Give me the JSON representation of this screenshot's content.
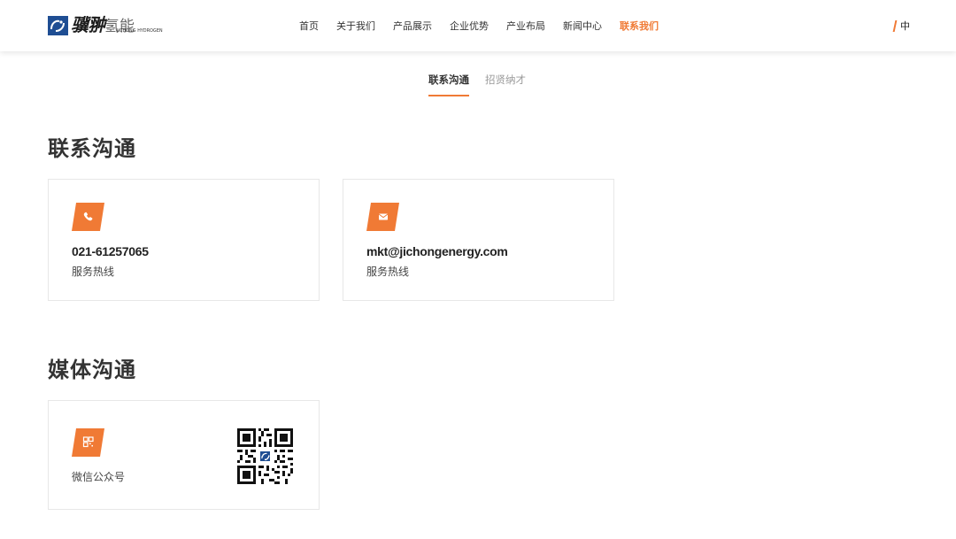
{
  "brand": {
    "name_cn": "骥翀",
    "name_cn_suffix": "氢能",
    "name_en": "JICHONG HYDROGEN"
  },
  "nav": {
    "items": [
      {
        "label": "首页"
      },
      {
        "label": "关于我们"
      },
      {
        "label": "产品展示"
      },
      {
        "label": "企业优势"
      },
      {
        "label": "产业布局"
      },
      {
        "label": "新闻中心"
      },
      {
        "label": "联系我们"
      }
    ],
    "active_index": 6
  },
  "lang": {
    "label": "中"
  },
  "subtabs": [
    {
      "label": "联系沟通",
      "active": true
    },
    {
      "label": "招贤纳才",
      "active": false
    }
  ],
  "contact": {
    "title": "联系沟通",
    "cards": [
      {
        "icon": "phone-icon",
        "value": "021-61257065",
        "label": "服务热线"
      },
      {
        "icon": "mail-icon",
        "value": "mkt@jichongenergy.com",
        "label": "服务热线"
      }
    ]
  },
  "media": {
    "title": "媒体沟通",
    "cards": [
      {
        "icon": "qrcode-icon",
        "label": "微信公众号"
      }
    ]
  },
  "colors": {
    "accent": "#f07a35",
    "brand_blue": "#1f4e93",
    "text": "#333333"
  }
}
